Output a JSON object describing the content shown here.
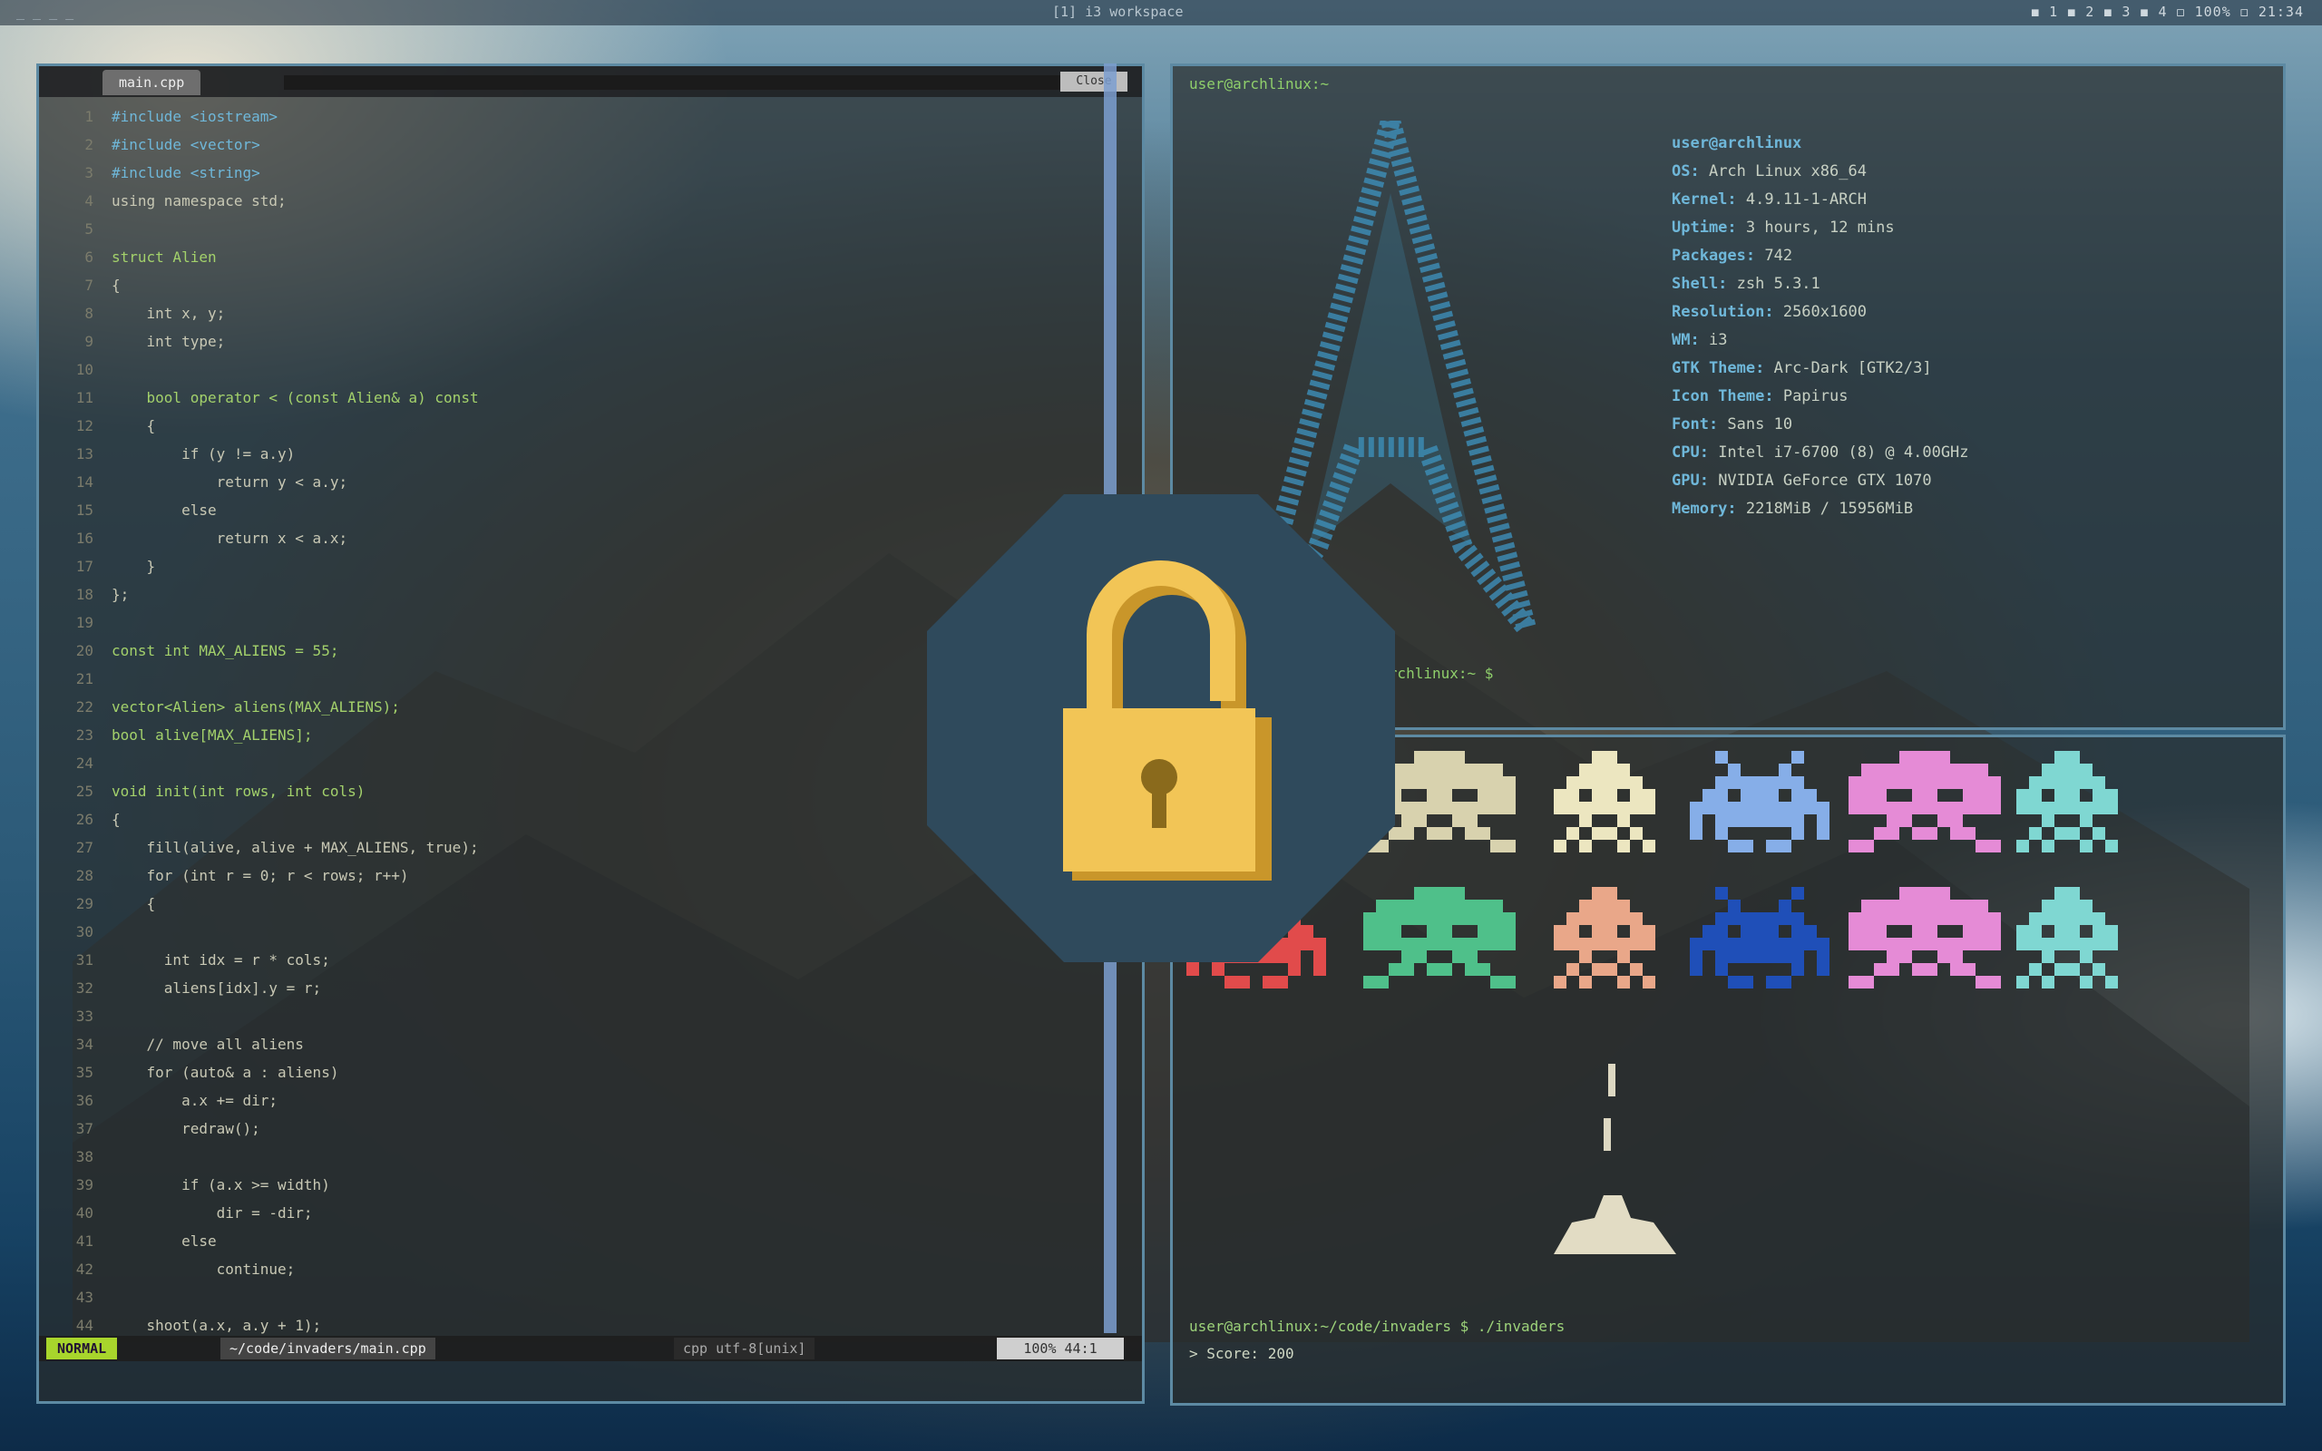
{
  "topbar": {
    "left": "_ _ _ _",
    "center": "[1] i3 workspace",
    "right": "◼ 1  ◼ 2  ◼ 3  ◼ 4   ◻ 100%   ◻ 21:34"
  },
  "editor": {
    "tab_label": "main.cpp",
    "tab_button": "Close",
    "lines": [
      {
        "n": "1",
        "t": "#include <iostream>"
      },
      {
        "n": "2",
        "t": "#include <vector>"
      },
      {
        "n": "3",
        "t": "#include <string>"
      },
      {
        "n": "4",
        "t": "using namespace std;"
      },
      {
        "n": "5",
        "t": ""
      },
      {
        "n": "6",
        "t": "struct Alien"
      },
      {
        "n": "7",
        "t": "{"
      },
      {
        "n": "8",
        "t": "    int x, y;"
      },
      {
        "n": "9",
        "t": "    int type;"
      },
      {
        "n": "10",
        "t": ""
      },
      {
        "n": "11",
        "t": "    bool operator < (const Alien& a) const"
      },
      {
        "n": "12",
        "t": "    {"
      },
      {
        "n": "13",
        "t": "        if (y != a.y)"
      },
      {
        "n": "14",
        "t": "            return y < a.y;"
      },
      {
        "n": "15",
        "t": "        else"
      },
      {
        "n": "16",
        "t": "            return x < a.x;"
      },
      {
        "n": "17",
        "t": "    }"
      },
      {
        "n": "18",
        "t": "};"
      },
      {
        "n": "19",
        "t": ""
      },
      {
        "n": "20",
        "t": "const int MAX_ALIENS = 55;"
      },
      {
        "n": "21",
        "t": ""
      },
      {
        "n": "22",
        "t": "vector<Alien> aliens(MAX_ALIENS);"
      },
      {
        "n": "23",
        "t": "bool alive[MAX_ALIENS];"
      },
      {
        "n": "24",
        "t": ""
      },
      {
        "n": "25",
        "t": "void init(int rows, int cols)"
      },
      {
        "n": "26",
        "t": "{"
      },
      {
        "n": "27",
        "t": "    fill(alive, alive + MAX_ALIENS, true);"
      },
      {
        "n": "28",
        "t": "    for (int r = 0; r < rows; r++)"
      },
      {
        "n": "29",
        "t": "    {"
      },
      {
        "n": "30",
        "t": ""
      },
      {
        "n": "31",
        "t": "      int idx = r * cols;"
      },
      {
        "n": "32",
        "t": "      aliens[idx].y = r;"
      },
      {
        "n": "33",
        "t": ""
      },
      {
        "n": "34",
        "t": "    // move all aliens"
      },
      {
        "n": "35",
        "t": "    for (auto& a : aliens)"
      },
      {
        "n": "36",
        "t": "        a.x += dir;"
      },
      {
        "n": "37",
        "t": "        redraw();"
      },
      {
        "n": "38",
        "t": ""
      },
      {
        "n": "39",
        "t": "        if (a.x >= width)"
      },
      {
        "n": "40",
        "t": "            dir = -dir;"
      },
      {
        "n": "41",
        "t": "        else"
      },
      {
        "n": "42",
        "t": "            continue;"
      },
      {
        "n": "43",
        "t": ""
      },
      {
        "n": "44",
        "t": "    shoot(a.x, a.y + 1);"
      }
    ],
    "status_mode": "NORMAL",
    "status_file": "~/code/invaders/main.cpp",
    "status_pos": "cpp  utf-8[unix]",
    "status_pct": "100%  44:1"
  },
  "neofetch": {
    "prompt": "user@archlinux:~",
    "info": [
      {
        "k": "",
        "v": "user@archlinux",
        "title": true
      },
      {
        "k": "OS:",
        "v": " Arch Linux x86_64"
      },
      {
        "k": "Kernel:",
        "v": " 4.9.11-1-ARCH"
      },
      {
        "k": "Uptime:",
        "v": " 3 hours, 12 mins"
      },
      {
        "k": "Packages:",
        "v": " 742"
      },
      {
        "k": "Shell:",
        "v": " zsh 5.3.1"
      },
      {
        "k": "Resolution:",
        "v": " 2560x1600"
      },
      {
        "k": "WM:",
        "v": " i3"
      },
      {
        "k": "GTK Theme:",
        "v": " Arc-Dark [GTK2/3]"
      },
      {
        "k": "Icon Theme:",
        "v": " Papirus"
      },
      {
        "k": "Font:",
        "v": " Sans 10"
      },
      {
        "k": "CPU:",
        "v": " Intel i7-6700 (8) @ 4.00GHz"
      },
      {
        "k": "GPU:",
        "v": " NVIDIA GeForce GTX 1070"
      },
      {
        "k": "Memory:",
        "v": " 2218MiB / 15956MiB"
      }
    ],
    "prompt2": "user@archlinux:~ $"
  },
  "terminal2": {
    "prompt": "user@archlinux:~/code/invaders $ ./invaders",
    "line2": "> Score: 200"
  },
  "lock": {
    "icon": "unlocked-padlock-icon",
    "colors": {
      "octagon": "#2f4a5c",
      "body": "#f2c556",
      "shackle": "#f2c556",
      "keyhole": "#8a6a1c"
    }
  },
  "colors": {
    "accent_border": "#5d8aa3",
    "divider": "#7d9fd0",
    "status_mode": "#a8d52c"
  }
}
